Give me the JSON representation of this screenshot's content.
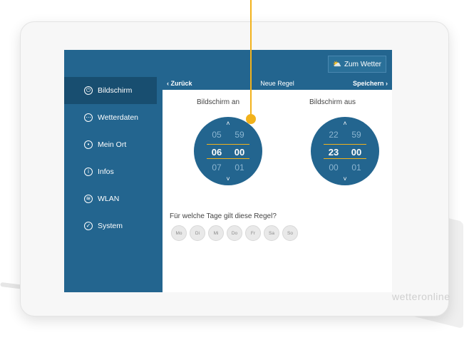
{
  "header": {
    "weather_button": "Zum Wetter",
    "weather_icon": "sun-cloud-icon"
  },
  "sidebar": {
    "items": [
      {
        "label": "Bildschirm",
        "icon": "power-icon",
        "active": true
      },
      {
        "label": "Wetterdaten",
        "icon": "dots-icon",
        "active": false
      },
      {
        "label": "Mein Ort",
        "icon": "location-icon",
        "active": false
      },
      {
        "label": "Infos",
        "icon": "info-icon",
        "active": false
      },
      {
        "label": "WLAN",
        "icon": "wifi-icon",
        "active": false
      },
      {
        "label": "System",
        "icon": "check-icon",
        "active": false
      }
    ]
  },
  "navbar": {
    "back": "Zurück",
    "title": "Neue Regel",
    "save": "Speichern"
  },
  "screen_on": {
    "label": "Bildschirm an",
    "prev": {
      "h": "05",
      "m": "59"
    },
    "selected": {
      "h": "06",
      "m": "00"
    },
    "next": {
      "h": "07",
      "m": "01"
    }
  },
  "screen_off": {
    "label": "Bildschirm aus",
    "prev": {
      "h": "22",
      "m": "59"
    },
    "selected": {
      "h": "23",
      "m": "00"
    },
    "next": {
      "h": "00",
      "m": "01"
    }
  },
  "days": {
    "question": "Für welche Tage gilt diese Regel?",
    "items": [
      "Mo",
      "Di",
      "Mi",
      "Do",
      "Fr",
      "Sa",
      "So"
    ]
  },
  "brand": "wetteronline",
  "colors": {
    "primary": "#23658f",
    "accent": "#f2b21b",
    "sidebar_active": "#184e70"
  }
}
